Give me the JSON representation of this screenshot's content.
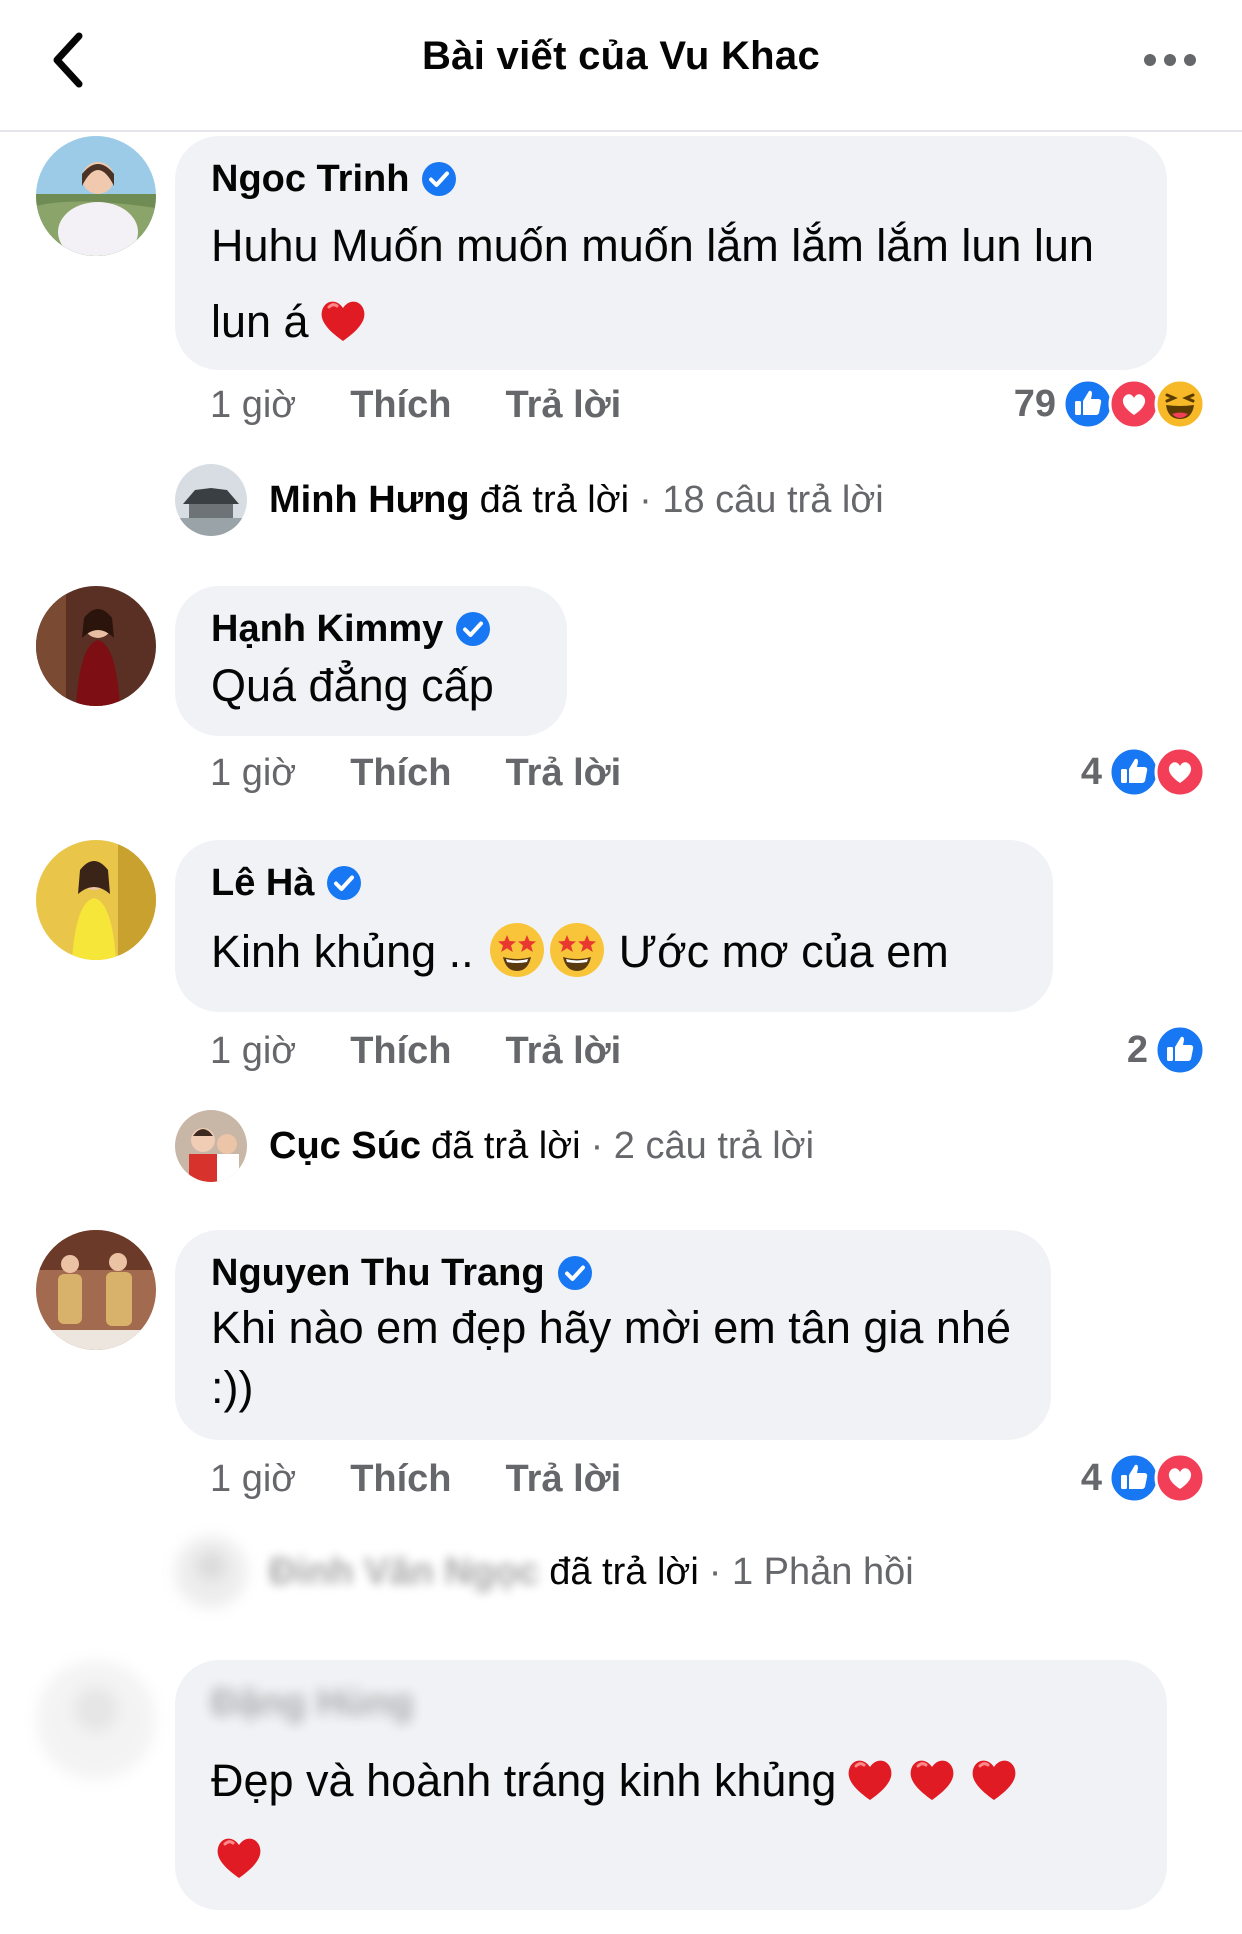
{
  "header": {
    "title": "Bài viết của Vu Khac",
    "back_icon": "chevron-left-icon",
    "more_icon": "more-horizontal-icon"
  },
  "colors": {
    "like_blue": "#1877f2",
    "love_red": "#f33e58",
    "haha_yellow": "#f7b928",
    "verified_blue": "#1877f2",
    "bubble_bg": "#f0f2f5",
    "meta_gray": "#65676b"
  },
  "comments": [
    {
      "author": "Ngoc Trinh",
      "text": "Huhu Muốn muốn muốn lắm lắm lắm lun lun lun á",
      "time": "1 giờ",
      "like_label": "Thích",
      "reply_label": "Trả lời",
      "reaction_count": "79",
      "reactions": [
        "like",
        "love",
        "haha"
      ]
    },
    {
      "author": "Hạnh Kimmy",
      "text": "Quá đẳng cấp",
      "time": "1 giờ",
      "like_label": "Thích",
      "reply_label": "Trả lời",
      "reaction_count": "4",
      "reactions": [
        "like",
        "love"
      ]
    },
    {
      "author": "Lê Hà",
      "text_before": "Kinh khủng ..",
      "text_after": "Ước mơ của em",
      "time": "1 giờ",
      "like_label": "Thích",
      "reply_label": "Trả lời",
      "reaction_count": "2",
      "reactions": [
        "like"
      ]
    },
    {
      "author": "Nguyen Thu Trang",
      "text": "Khi nào em đẹp hãy mời em tân gia nhé :))",
      "time": "1 giờ",
      "like_label": "Thích",
      "reply_label": "Trả lời",
      "reaction_count": "4",
      "reactions": [
        "like",
        "love"
      ]
    },
    {
      "author": "Đặng Hùng",
      "text": "Đẹp và hoành tráng kinh khủng"
    }
  ],
  "replies": [
    {
      "name": "Minh Hưng",
      "text": "đã trả lời",
      "count": "· 18 câu trả lời"
    },
    {
      "name": "Cục Súc",
      "text": "đã trả lời",
      "count": "· 2 câu trả lời"
    },
    {
      "name": "Đinh Văn Ngọc",
      "text": "đã trả lời",
      "count": "· 1 Phản hồi"
    }
  ]
}
